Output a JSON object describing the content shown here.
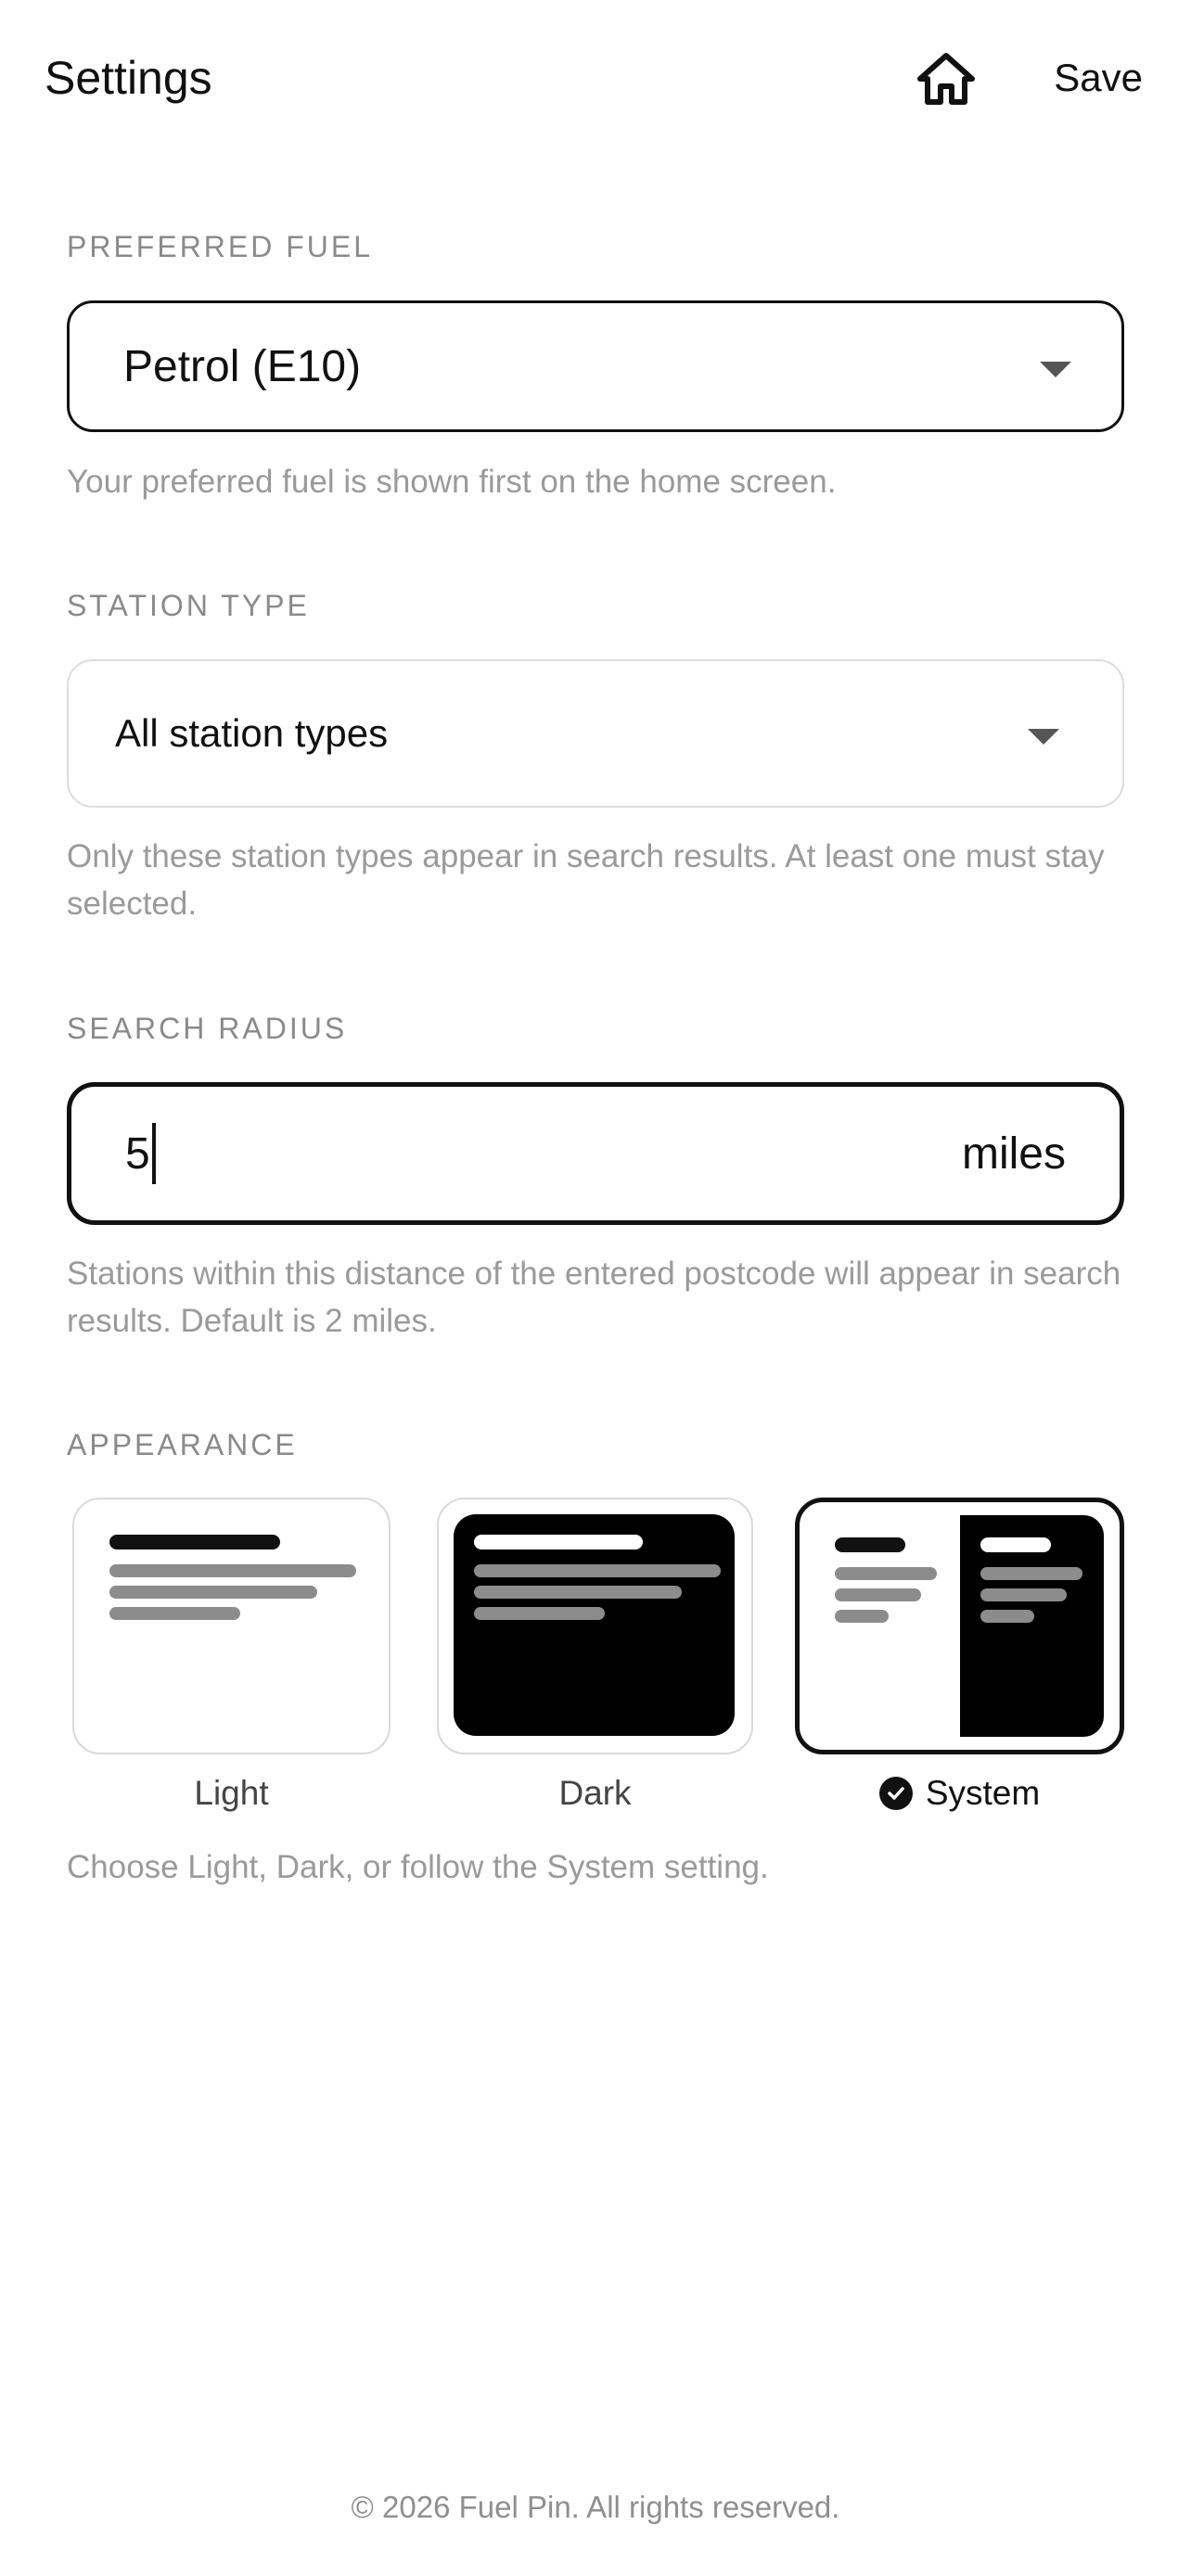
{
  "header": {
    "title": "Settings",
    "home_icon": "home-icon",
    "save_label": "Save"
  },
  "preferred_fuel": {
    "label": "PREFERRED FUEL",
    "value": "Petrol (E10)",
    "helper": "Your preferred fuel is shown first on the home screen."
  },
  "station_type": {
    "label": "STATION TYPE",
    "value": "All station types",
    "helper": "Only these station types appear in search results. At least one must stay selected."
  },
  "search_radius": {
    "label": "SEARCH RADIUS",
    "value": "5",
    "unit": "miles",
    "helper": "Stations within this distance of the entered postcode will appear in search results. Default is 2 miles."
  },
  "appearance": {
    "label": "APPEARANCE",
    "options": [
      {
        "label": "Light",
        "selected": false
      },
      {
        "label": "Dark",
        "selected": false
      },
      {
        "label": "System",
        "selected": true
      }
    ],
    "helper": "Choose Light, Dark, or follow the System setting."
  },
  "footer": {
    "text": "© 2026 Fuel Pin. All rights reserved."
  },
  "colors": {
    "text": "#111111",
    "muted": "#9a9a9a",
    "border_light": "#dcdcdc",
    "preview_bar": "#8c8c8c"
  }
}
